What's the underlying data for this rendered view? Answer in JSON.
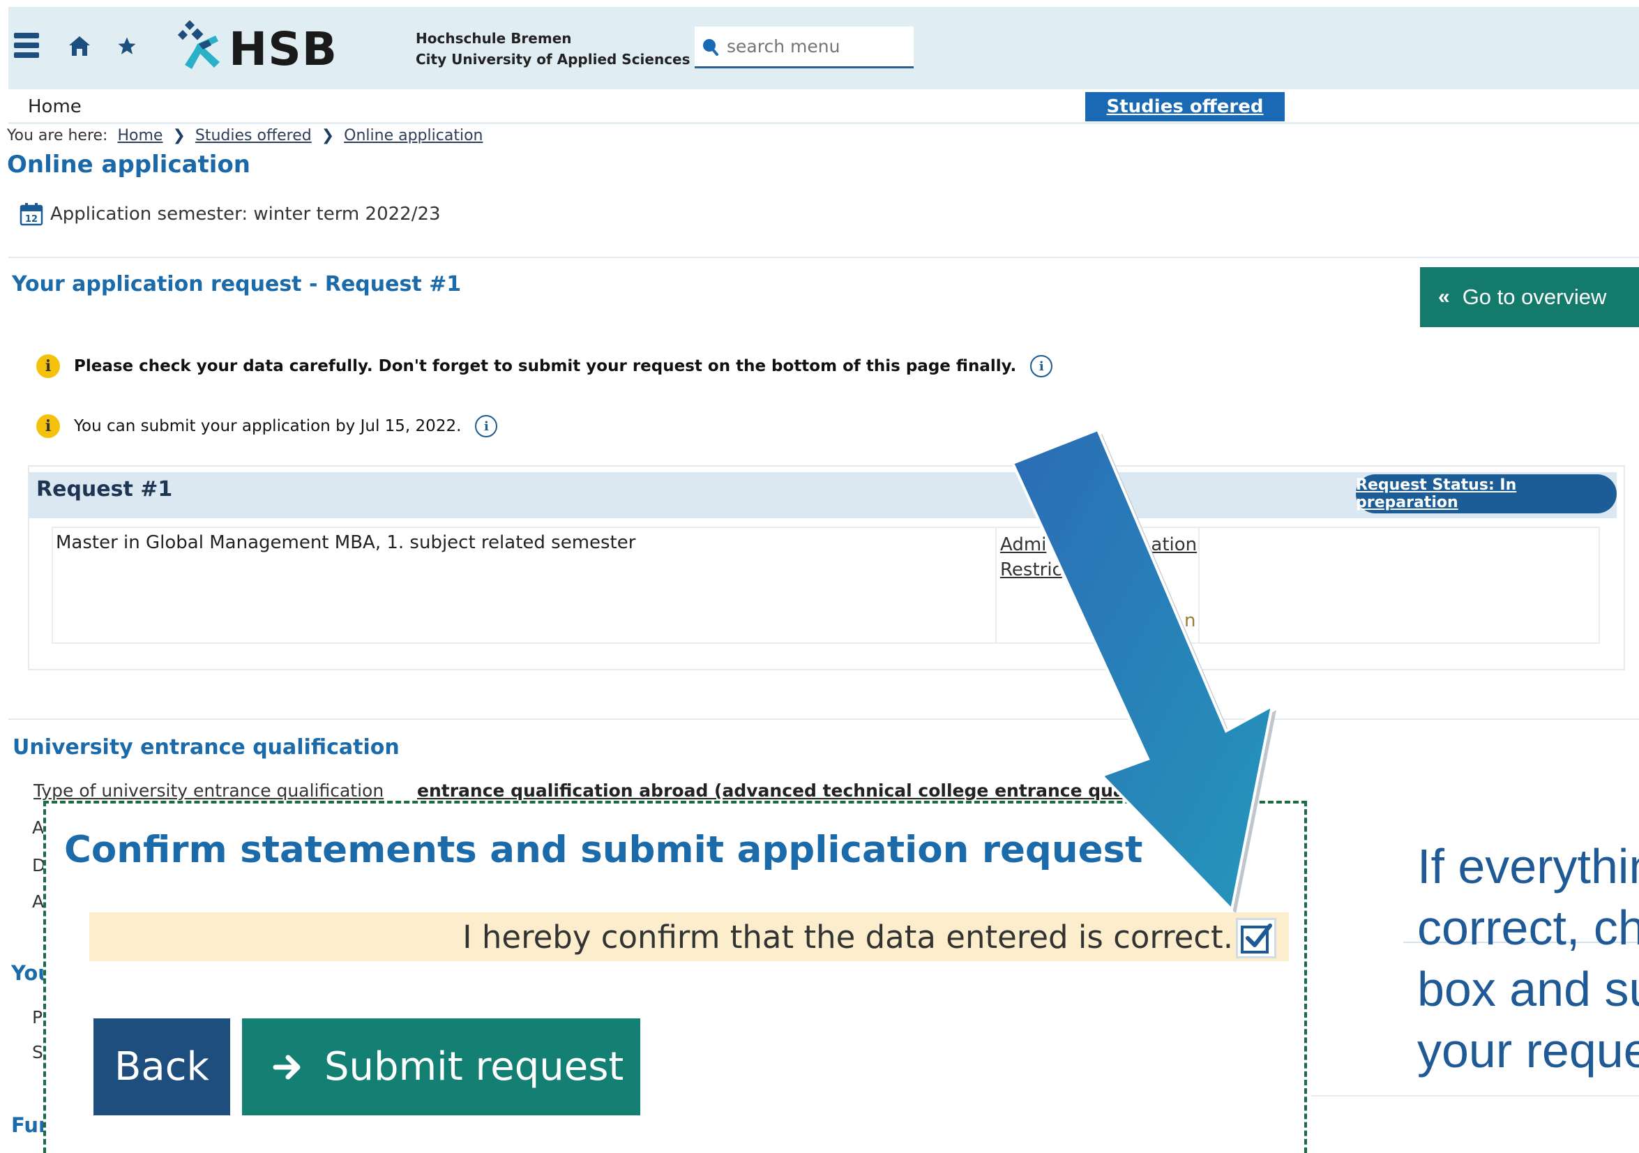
{
  "header": {
    "logo_text": "HSB",
    "uni_line1": "Hochschule Bremen",
    "uni_line2": "City University of Applied Sciences",
    "search_placeholder": "search menu",
    "icons": [
      "menu-icon",
      "home-icon",
      "star-icon",
      "hsb-logo-mark",
      "search-icon"
    ]
  },
  "nav": {
    "home": "Home",
    "studies_offered": "Studies offered"
  },
  "breadcrumb": {
    "prefix": "You are here:",
    "items": [
      "Home",
      "Studies offered",
      "Online application"
    ]
  },
  "page_title": "Online application",
  "semester_text": "Application semester: winter term 2022/23",
  "request_section": {
    "heading": "Your application request - Request #1",
    "overview_button": "Go to overview"
  },
  "notices": [
    "Please check your data carefully. Don't forget to submit your request on the bottom of this page finally.",
    "You can submit your application by Jul 15, 2022."
  ],
  "request_card": {
    "title": "Request #1",
    "status": "Request Status: In preparation",
    "program": "Master in Global Management MBA, 1. subject related semester",
    "admission_line1": "Admi",
    "admission_line1_tail": "ation",
    "admission_line2": "Restric",
    "admission_tail": "n"
  },
  "entrance": {
    "heading": "University entrance qualification",
    "type_label": "Type of university entrance qualification",
    "type_value": "entrance qualification abroad (advanced technical college entrance qualificatio",
    "stubs": [
      "A",
      "D",
      "A"
    ]
  },
  "stub_headings": [
    "You",
    "Fur"
  ],
  "stub_rows": [
    "P",
    "S"
  ],
  "confirm": {
    "title": "Confirm statements and submit application request",
    "statement": "I hereby confirm that the data entered is correct.",
    "checked": true,
    "back_label": "Back",
    "submit_label": "Submit request"
  },
  "instruction_text": "If everything is\ncorrect, check the\nbox and submit\nyour request",
  "colors": {
    "header_bg": "#e0eef3",
    "primary_blue": "#1b6aa9",
    "teal": "#148074",
    "dark_blue": "#1d4e7d",
    "arrow": "#2a7fbe"
  }
}
